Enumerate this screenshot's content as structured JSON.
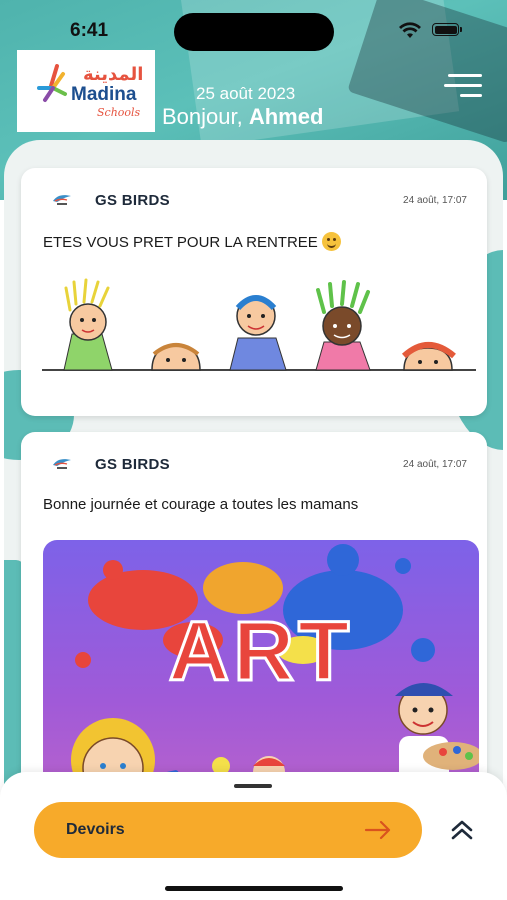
{
  "status_bar": {
    "time": "6:41"
  },
  "logo": {
    "arabic": "المدينة",
    "name": "Madina",
    "sub": "Schools"
  },
  "header": {
    "date": "25 août 2023",
    "greeting_prefix": "Bonjour, ",
    "user_name": "Ahmed"
  },
  "posts": [
    {
      "author": "GS BIRDS",
      "time": "24 août, 17:07",
      "text": "ETES VOUS PRET POUR LA RENTREE"
    },
    {
      "author": "GS BIRDS",
      "time": "24 août, 17:07",
      "text": "Bonne journée et courage a toutes les mamans",
      "image_text": "ART"
    }
  ],
  "bottom": {
    "devoirs_label": "Devoirs"
  },
  "colors": {
    "accent": "#f7aa2a",
    "teal": "#5cbcb6",
    "navy": "#1e2a3a"
  }
}
